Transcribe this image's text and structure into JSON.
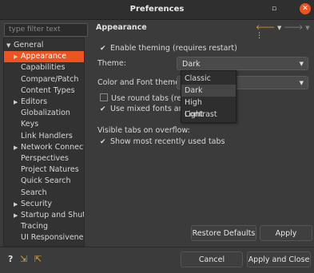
{
  "window": {
    "title": "Preferences",
    "minimize": "▫",
    "close": "✕"
  },
  "filter": {
    "placeholder": "type filter text"
  },
  "tree": [
    {
      "label": "General",
      "caret": "▼",
      "indent": 0
    },
    {
      "label": "Appearance",
      "caret": "▶",
      "indent": 1,
      "selected": true
    },
    {
      "label": "Capabilities",
      "caret": "",
      "indent": 1
    },
    {
      "label": "Compare/Patch",
      "caret": "",
      "indent": 1
    },
    {
      "label": "Content Types",
      "caret": "",
      "indent": 1
    },
    {
      "label": "Editors",
      "caret": "▶",
      "indent": 1
    },
    {
      "label": "Globalization",
      "caret": "",
      "indent": 1
    },
    {
      "label": "Keys",
      "caret": "",
      "indent": 1
    },
    {
      "label": "Link Handlers",
      "caret": "",
      "indent": 1
    },
    {
      "label": "Network Connectio",
      "caret": "▶",
      "indent": 1
    },
    {
      "label": "Perspectives",
      "caret": "",
      "indent": 1
    },
    {
      "label": "Project Natures",
      "caret": "",
      "indent": 1
    },
    {
      "label": "Quick Search",
      "caret": "",
      "indent": 1
    },
    {
      "label": "Search",
      "caret": "",
      "indent": 1
    },
    {
      "label": "Security",
      "caret": "▶",
      "indent": 1
    },
    {
      "label": "Startup and Shutdo",
      "caret": "▶",
      "indent": 1
    },
    {
      "label": "Tracing",
      "caret": "",
      "indent": 1
    },
    {
      "label": "UI Responsiveness",
      "caret": "",
      "indent": 1
    }
  ],
  "pane": {
    "title": "Appearance",
    "enable_theming": "Enable theming (requires restart)",
    "theme_label": "Theme:",
    "theme_value": "Dark",
    "color_font_label": "Color and Font theme:",
    "round_tabs": "Use round tabs (requi",
    "mixed_fonts": "Use mixed fonts and c",
    "visible_tabs_label": "Visible tabs on overflow:",
    "show_recent_tabs": "Show most recently used tabs"
  },
  "theme_options": [
    "Classic",
    "Dark",
    "High Contrast",
    "Light"
  ],
  "buttons": {
    "restore_defaults": "Restore Defaults",
    "apply": "Apply",
    "cancel": "Cancel",
    "apply_close": "Apply and Close"
  },
  "icons": {
    "nav_back": "🡐",
    "nav_forward": "🡒",
    "menu": "⋮",
    "help": "?",
    "import": "⇲",
    "export": "⇱"
  },
  "colors": {
    "accent": "#e95420",
    "background": "#3b3b3b"
  }
}
